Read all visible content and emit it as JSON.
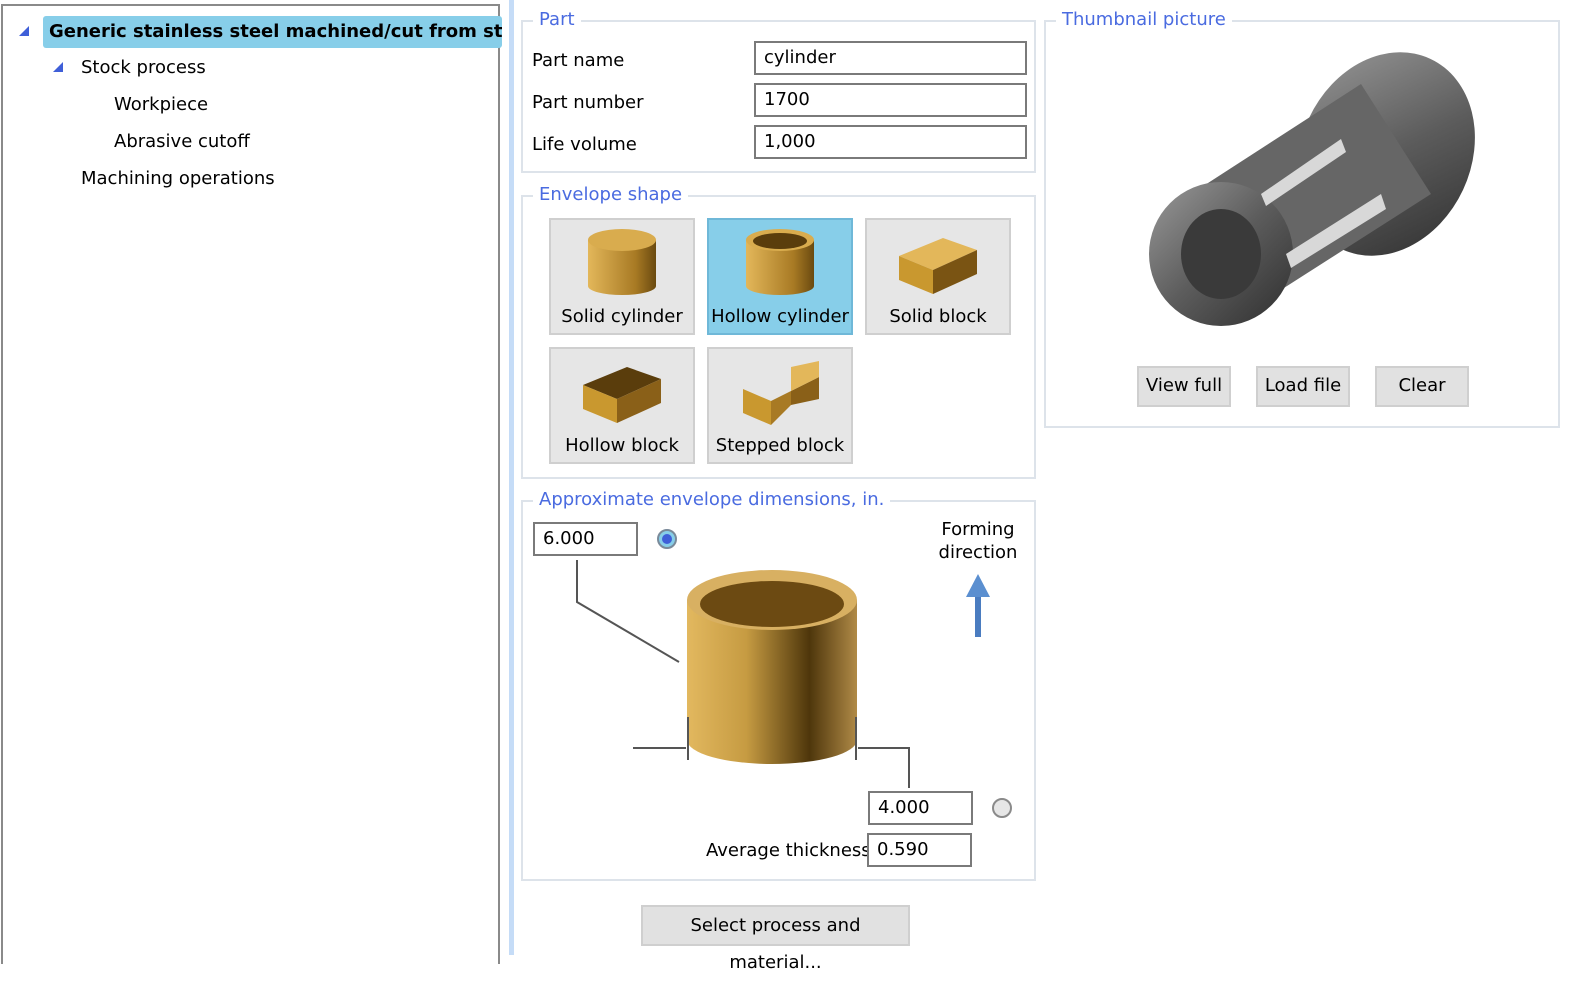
{
  "tree": {
    "root": "Generic stainless steel machined/cut from stock",
    "stock_process": "Stock process",
    "workpiece": "Workpiece",
    "abrasive_cutoff": "Abrasive cutoff",
    "machining_operations": "Machining operations"
  },
  "part": {
    "legend": "Part",
    "name_label": "Part name",
    "name_value": "cylinder",
    "number_label": "Part number",
    "number_value": "1700",
    "life_label": "Life volume",
    "life_value": "1,000"
  },
  "envelope": {
    "legend": "Envelope shape",
    "shapes": [
      {
        "label": "Solid cylinder"
      },
      {
        "label": "Hollow cylinder",
        "selected": true
      },
      {
        "label": "Solid block"
      },
      {
        "label": "Hollow block"
      },
      {
        "label": "Stepped block"
      }
    ]
  },
  "dimensions": {
    "legend": "Approximate envelope dimensions, in.",
    "height": "6.000",
    "diameter": "4.000",
    "thickness_label": "Average thickness",
    "thickness": "0.590",
    "forming_label": "Forming direction",
    "selected_radio": "height"
  },
  "thumbnail": {
    "legend": "Thumbnail picture",
    "view_full": "View full",
    "load_file": "Load file",
    "clear": "Clear"
  },
  "select_button": "Select process and material..."
}
